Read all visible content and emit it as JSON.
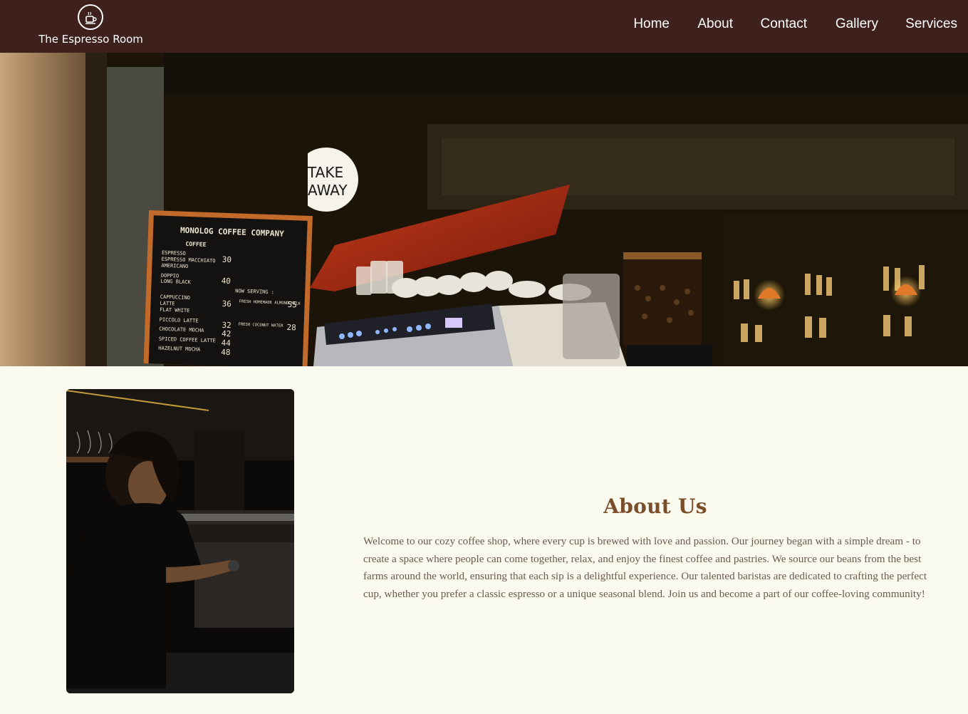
{
  "header": {
    "brand": {
      "name": "The Espresso Room",
      "logo_icon": "coffee-cup-icon"
    },
    "nav": [
      {
        "label": "Home"
      },
      {
        "label": "About"
      },
      {
        "label": "Contact"
      },
      {
        "label": "Gallery"
      },
      {
        "label": "Services"
      }
    ]
  },
  "hero": {
    "menu_board": {
      "title": "MONOLOG COFFEE COMPANY",
      "section": "COFFEE",
      "items": [
        "ESPRESSO",
        "ESPRESSO MACCHIATO",
        "AMERICANO",
        "DOPPIO",
        "LONG BLACK",
        "CAPPUCCINO",
        "LATTE",
        "FLAT WHITE",
        "PICCOLO LATTE",
        "CHOCOLATE MOCHA",
        "SPICED COFFEE LATTE",
        "HAZELNUT MOCHA"
      ],
      "prices": [
        "30",
        "40",
        "36",
        "32",
        "42",
        "44",
        "48"
      ],
      "now_serving": "NOW SERVING :",
      "specials": [
        "FRESH HOMEMADE ALMOND MILK",
        "FRESH COCONUT WATER"
      ],
      "special_prices": [
        "55",
        "28"
      ]
    },
    "take_away_sign": [
      "TAKE",
      "AWAY"
    ]
  },
  "about": {
    "title": "About Us",
    "body": "Welcome to our cozy coffee shop, where every cup is brewed with love and passion. Our journey began with a simple dream - to create a space where people can come together, relax, and enjoy the finest coffee and pastries. We source our beans from the best farms around the world, ensuring that each sip is a delightful experience. Our talented baristas are dedicated to crafting the perfect cup, whether you prefer a classic espresso or a unique seasonal blend. Join us and become a part of our coffee-loving community!"
  },
  "colors": {
    "header_bg": "#3e211c",
    "page_bg": "#fbfaee",
    "title": "#7a4e2b",
    "body_text": "#6a5a50"
  }
}
